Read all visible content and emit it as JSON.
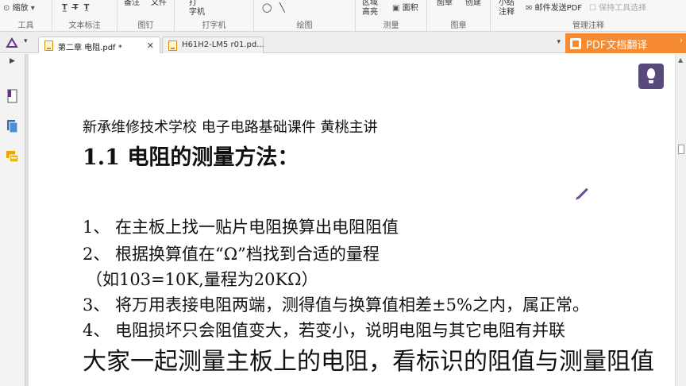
{
  "ribbon": {
    "zoom_label": "缩放",
    "groups": {
      "tools": "工具",
      "text_markup": "文本标注",
      "pin": "图钉",
      "typewriter": "打字机",
      "drawing": "绘图",
      "measure": "测量",
      "stamp": "图章",
      "manage_comments": "管理注释"
    },
    "buttons": {
      "note": "备注",
      "file": "文件",
      "typewriter_top": "打",
      "typewriter_bottom": "字机",
      "highlight_top": "区域",
      "highlight_bottom": "高亮",
      "area": "面积",
      "stamp": "图章",
      "create": "创建",
      "summarize_top": "小结",
      "summarize_bottom": "注释",
      "email_pdf": "邮件发送PDF",
      "keep_tool": "保持工具选择"
    }
  },
  "tabs": [
    {
      "label": "第二章 电阻.pdf *",
      "active": true
    },
    {
      "label": "H61H2-LM5 r01.pd...",
      "active": false
    }
  ],
  "translate_button": "PDF文档翻译",
  "document": {
    "header": "新承维修技术学校  电子电路基础课件  黄桃主讲",
    "title": "1.1 电阻的测量方法：",
    "steps": {
      "s1": "1、  在主板上找一贴片电阻换算出电阻阻值",
      "s2": "2、  根据换算值在“Ω”档找到合适的量程",
      "s2_note": "（如103=10K,量程为20KΩ）",
      "s3": "3、  将万用表接电阻两端，测得值与换算值相差±5%之内，属正常。",
      "s4": "4、  电阻损坏只会阻值变大，若变小，说明电阻与其它电阻有并联"
    },
    "caption": "大家一起测量主板上的电阻，看标识的阻值与测量阻值"
  },
  "colors": {
    "accent_orange": "#f58a33",
    "lightbulb_purple": "#5a4a7c"
  }
}
